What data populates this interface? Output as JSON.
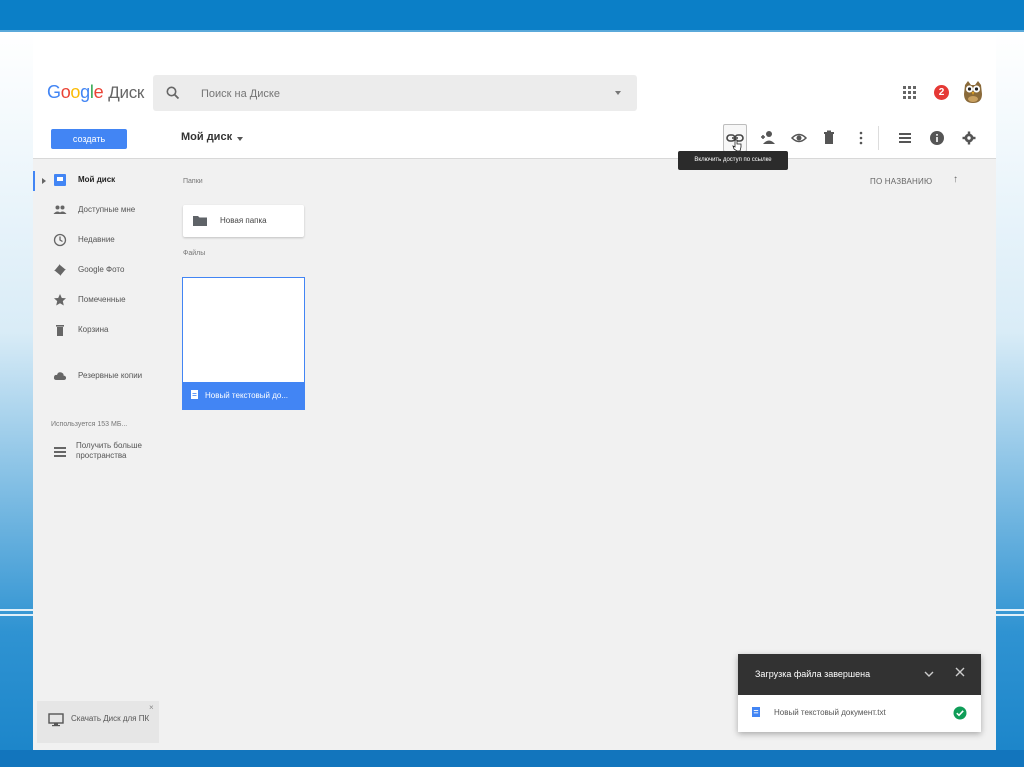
{
  "app": {
    "logo_google": [
      "G",
      "o",
      "o",
      "g",
      "l",
      "e"
    ],
    "product": "Диск",
    "notification_count": "2"
  },
  "search": {
    "placeholder": "Поиск на Диске"
  },
  "toolbar": {
    "create_label": "создать",
    "breadcrumb": "Мой диск",
    "tooltip": "Включить доступ по ссылке",
    "icons": [
      "link-icon",
      "share-person-icon",
      "preview-eye-icon",
      "trash-icon",
      "more-vert-icon",
      "list-view-icon",
      "info-icon",
      "settings-gear-icon"
    ]
  },
  "sidebar": {
    "items": [
      {
        "label": "Мой диск",
        "icon": "my-drive-icon",
        "active": true
      },
      {
        "label": "Доступные мне",
        "icon": "shared-people-icon"
      },
      {
        "label": "Недавние",
        "icon": "clock-icon"
      },
      {
        "label": "Google Фото",
        "icon": "photos-icon"
      },
      {
        "label": "Помеченные",
        "icon": "star-icon"
      },
      {
        "label": "Корзина",
        "icon": "trash-icon"
      },
      {
        "label": "Резервные копии",
        "icon": "cloud-icon"
      }
    ],
    "storage_used": "Используется 153 МБ...",
    "more_storage": "Получить больше пространства",
    "download_desktop": "Скачать Диск для ПК",
    "close_glyph": "×"
  },
  "main": {
    "folders_label": "Папки",
    "files_label": "Файлы",
    "sort_label": "ПО НАЗВАНИЮ",
    "sort_arrow": "↑",
    "folders": [
      {
        "name": "Новая папка"
      }
    ],
    "files": [
      {
        "name": "Новый текстовый до..."
      }
    ]
  },
  "upload_panel": {
    "title": "Загрузка файла завершена",
    "file_name": "Новый текстовый документ.txt",
    "status": "complete"
  },
  "colors": {
    "accent": "#4285f4",
    "frame_blue": "#0b7fc7",
    "success": "#0f9d58",
    "badge_red": "#e53935"
  }
}
